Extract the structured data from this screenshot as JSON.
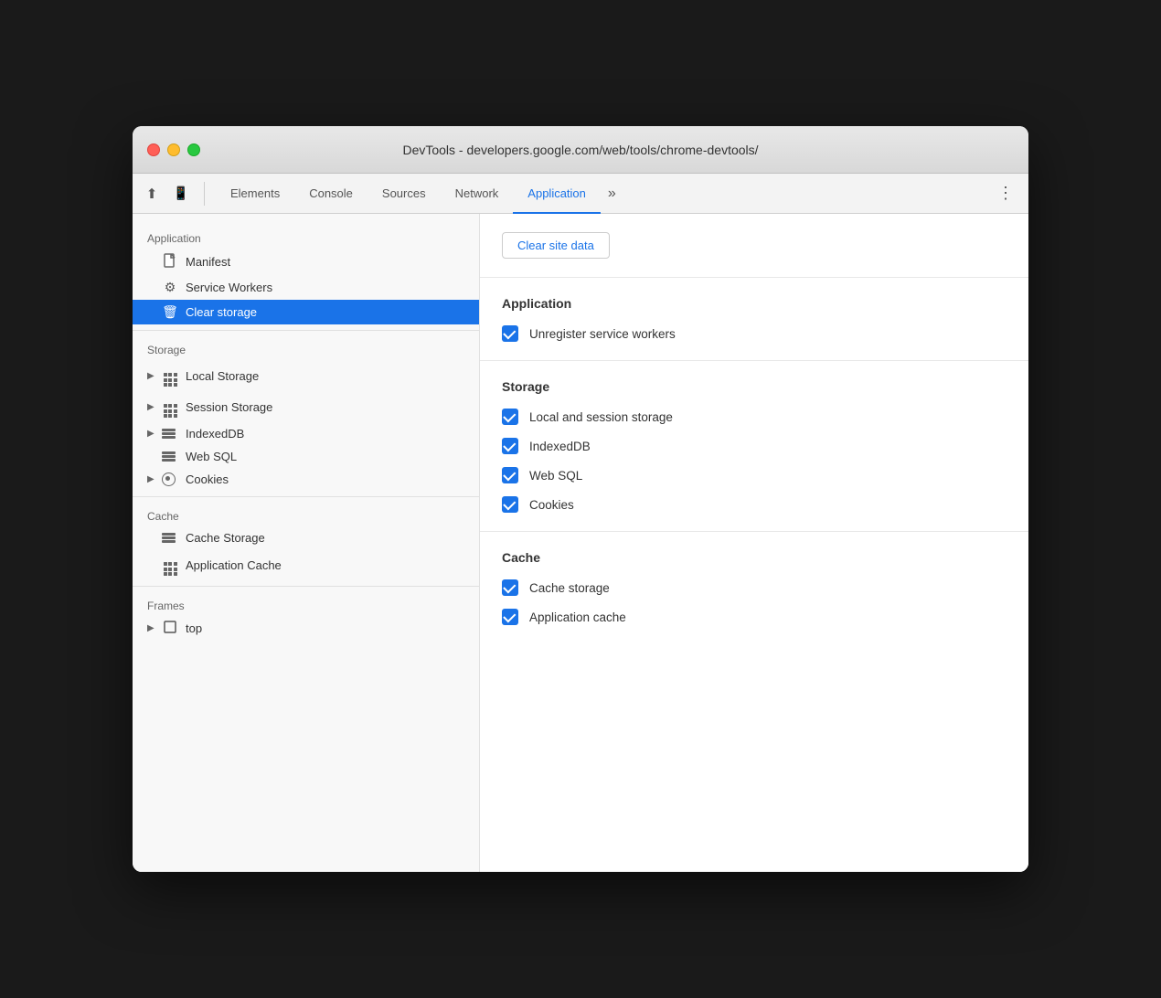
{
  "window": {
    "title": "DevTools - developers.google.com/web/tools/chrome-devtools/"
  },
  "tabs": {
    "items": [
      {
        "id": "elements",
        "label": "Elements",
        "active": false
      },
      {
        "id": "console",
        "label": "Console",
        "active": false
      },
      {
        "id": "sources",
        "label": "Sources",
        "active": false
      },
      {
        "id": "network",
        "label": "Network",
        "active": false
      },
      {
        "id": "application",
        "label": "Application",
        "active": true
      }
    ],
    "overflow_label": "»",
    "more_label": "⋮"
  },
  "sidebar": {
    "sections": [
      {
        "id": "application",
        "label": "Application",
        "items": [
          {
            "id": "manifest",
            "label": "Manifest",
            "icon": "doc",
            "expandable": false,
            "active": false
          },
          {
            "id": "service-workers",
            "label": "Service Workers",
            "icon": "gear",
            "expandable": false,
            "active": false
          },
          {
            "id": "clear-storage",
            "label": "Clear storage",
            "icon": "trash",
            "expandable": false,
            "active": true
          }
        ]
      },
      {
        "id": "storage",
        "label": "Storage",
        "items": [
          {
            "id": "local-storage",
            "label": "Local Storage",
            "icon": "grid",
            "expandable": true,
            "active": false
          },
          {
            "id": "session-storage",
            "label": "Session Storage",
            "icon": "grid",
            "expandable": true,
            "active": false
          },
          {
            "id": "indexeddb",
            "label": "IndexedDB",
            "icon": "stack",
            "expandable": true,
            "active": false
          },
          {
            "id": "web-sql",
            "label": "Web SQL",
            "icon": "stack",
            "expandable": false,
            "active": false
          },
          {
            "id": "cookies",
            "label": "Cookies",
            "icon": "cookie",
            "expandable": true,
            "active": false
          }
        ]
      },
      {
        "id": "cache",
        "label": "Cache",
        "items": [
          {
            "id": "cache-storage",
            "label": "Cache Storage",
            "icon": "stack",
            "expandable": false,
            "active": false
          },
          {
            "id": "application-cache",
            "label": "Application Cache",
            "icon": "grid",
            "expandable": false,
            "active": false
          }
        ]
      },
      {
        "id": "frames",
        "label": "Frames",
        "items": [
          {
            "id": "top",
            "label": "top",
            "icon": "frame",
            "expandable": true,
            "active": false
          }
        ]
      }
    ]
  },
  "content": {
    "clear_button_label": "Clear site data",
    "sections": [
      {
        "id": "application",
        "title": "Application",
        "items": [
          {
            "id": "unregister-workers",
            "label": "Unregister service workers",
            "checked": true
          }
        ]
      },
      {
        "id": "storage",
        "title": "Storage",
        "items": [
          {
            "id": "local-session-storage",
            "label": "Local and session storage",
            "checked": true
          },
          {
            "id": "indexeddb",
            "label": "IndexedDB",
            "checked": true
          },
          {
            "id": "web-sql",
            "label": "Web SQL",
            "checked": true
          },
          {
            "id": "cookies",
            "label": "Cookies",
            "checked": true
          }
        ]
      },
      {
        "id": "cache",
        "title": "Cache",
        "items": [
          {
            "id": "cache-storage",
            "label": "Cache storage",
            "checked": true
          },
          {
            "id": "application-cache",
            "label": "Application cache",
            "checked": true
          }
        ]
      }
    ]
  }
}
